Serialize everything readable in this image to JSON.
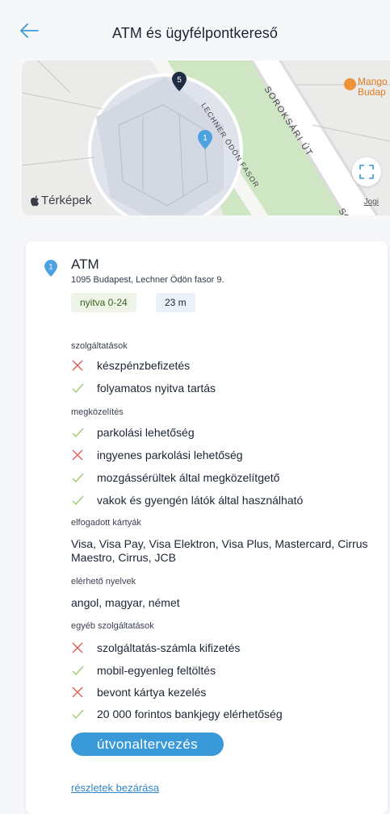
{
  "header": {
    "title": "ATM és ügyfélpontkereső",
    "back_icon": "arrow-left-icon"
  },
  "map": {
    "brand": "Térképek",
    "legal_link": "Jogi",
    "street_1": "SOROKSÁRI ÚT",
    "street_2": "LECHNER ÖDÖN FASOR",
    "street_2_fragment": "SO",
    "poi_label_line1": "Mango",
    "poi_label_line2": "Budap",
    "markers": [
      "1",
      "5"
    ],
    "colors": {
      "park": "#cfe6c4",
      "road": "#ffffff",
      "highlight": "#3a9ad9",
      "poi": "#f0923a"
    }
  },
  "atm": {
    "marker_number": "1",
    "title": "ATM",
    "address": "1095 Budapest, Lechner Ödön fasor 9.",
    "opening": "nyitva 0-24",
    "distance": "23 m"
  },
  "services": {
    "label": "szolgáltatások",
    "items": [
      {
        "label": "készpénzbefizetés",
        "available": false
      },
      {
        "label": "folyamatos nyitva tartás",
        "available": true
      }
    ]
  },
  "approach": {
    "label": "megközelítés",
    "items": [
      {
        "label": "parkolási lehetőség",
        "available": true
      },
      {
        "label": "ingyenes parkolási lehetőség",
        "available": false
      },
      {
        "label": "mozgássérültek által megközelítgető",
        "available": true
      },
      {
        "label": "vakok és gyengén látók által használható",
        "available": true
      }
    ]
  },
  "cards": {
    "label": "elfogadott kártyák",
    "text": "Visa,  Visa Pay,  Visa Elektron,  Visa Plus,  Mastercard,  Cirrus Maestro,  Cirrus,  JCB"
  },
  "languages": {
    "label": "elérhető nyelvek",
    "text": "angol, magyar, német"
  },
  "other": {
    "label": "egyéb szolgáltatások",
    "items": [
      {
        "label": "szolgáltatás-számla kifizetés",
        "available": false
      },
      {
        "label": "mobil-egyenleg feltöltés",
        "available": true
      },
      {
        "label": "bevont kártya kezelés",
        "available": false
      },
      {
        "label": "20 000 forintos bankjegy elérhetőség",
        "available": true
      }
    ]
  },
  "actions": {
    "route": "útvonaltervezés",
    "close": "részletek bezárása"
  },
  "colors": {
    "check": "#9ccc6e",
    "cross": "#e35b56",
    "accent": "#3a9ad9"
  }
}
